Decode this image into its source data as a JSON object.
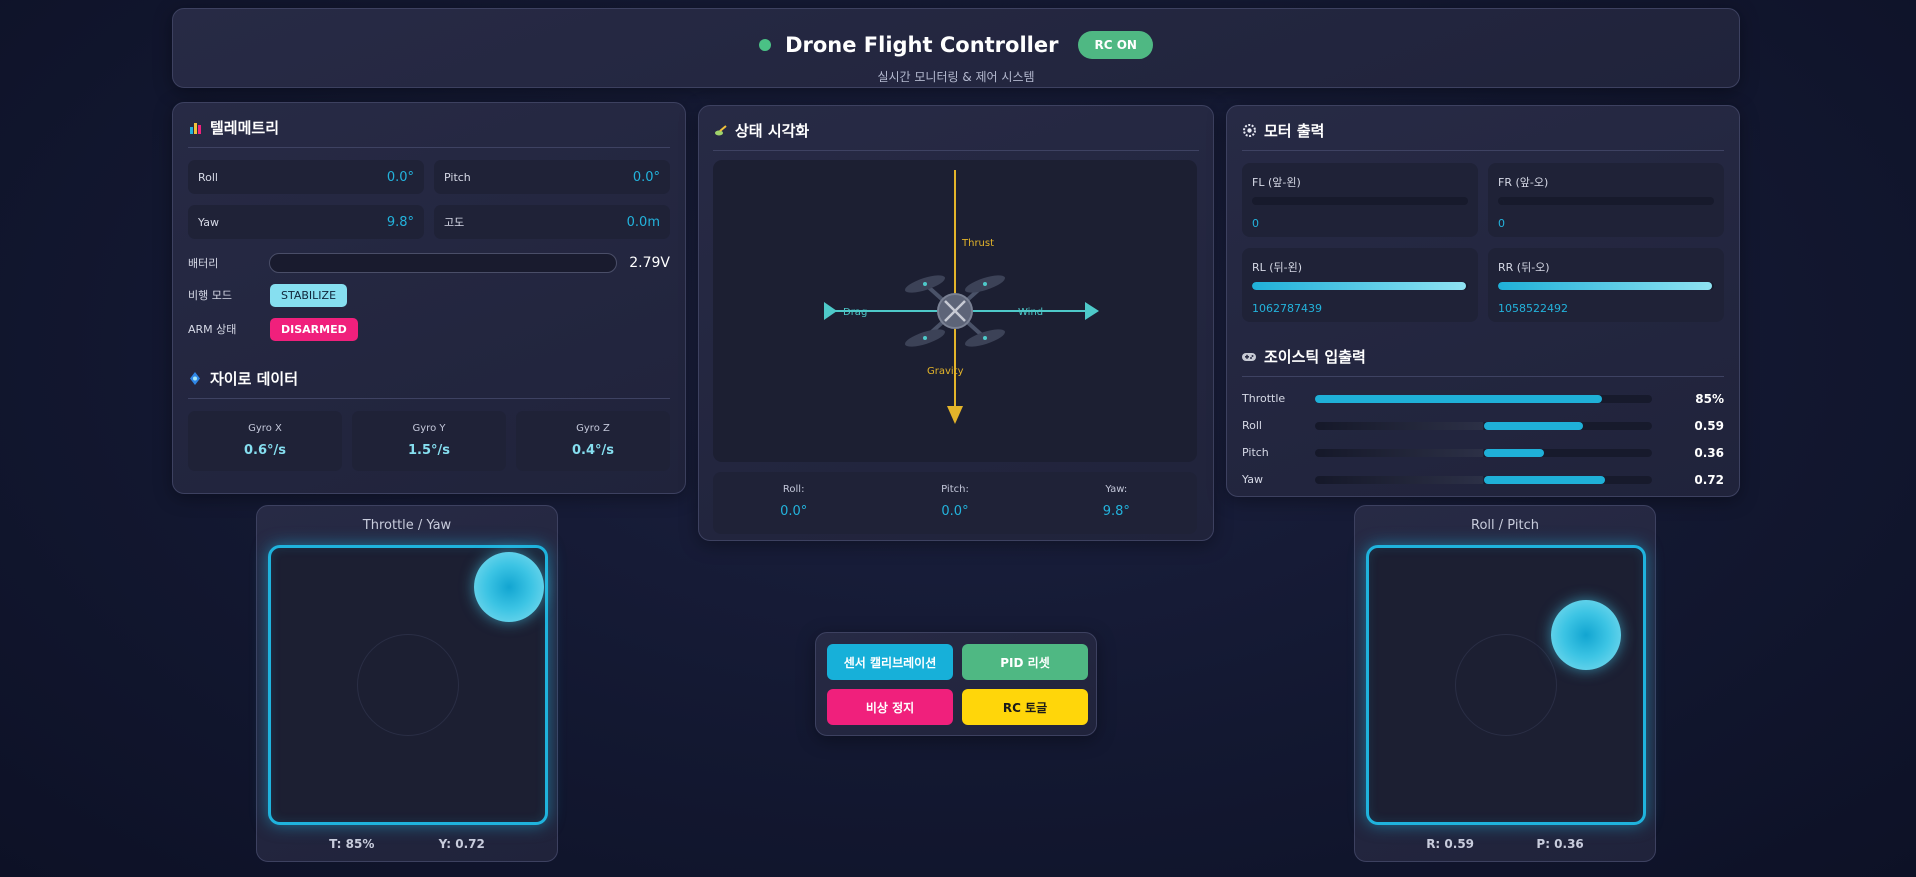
{
  "header": {
    "title": "Drone Flight Controller",
    "rc_badge": "RC ON",
    "subtitle": "실시간 모니터링 & 제어 시스템",
    "status_color": "#4ac185"
  },
  "telemetry": {
    "title": "텔레메트리",
    "icon": "bar-chart-icon",
    "cells": [
      {
        "label": "Roll",
        "value": "0.0°"
      },
      {
        "label": "Pitch",
        "value": "0.0°"
      },
      {
        "label": "Yaw",
        "value": "9.8°"
      },
      {
        "label": "고도",
        "value": "0.0m"
      }
    ],
    "battery_label": "배터리",
    "battery_value": "2.79V",
    "battery_level": 0.0,
    "mode_label": "비행 모드",
    "mode_value": "STABILIZE",
    "arm_label": "ARM 상태",
    "arm_value": "DISARMED"
  },
  "gyro": {
    "title": "자이로 데이터",
    "icon": "gyro-icon",
    "cells": [
      {
        "label": "Gyro X",
        "value": "0.6°/s"
      },
      {
        "label": "Gyro Y",
        "value": "1.5°/s"
      },
      {
        "label": "Gyro Z",
        "value": "0.4°/s"
      }
    ]
  },
  "visual": {
    "title": "상태 시각화",
    "icon": "drone-icon",
    "forces": {
      "thrust": "Thrust",
      "gravity": "Gravity",
      "drag": "Drag",
      "wind": "Wind"
    },
    "readout": [
      {
        "label": "Roll:",
        "value": "0.0°"
      },
      {
        "label": "Pitch:",
        "value": "0.0°"
      },
      {
        "label": "Yaw:",
        "value": "9.8°"
      }
    ]
  },
  "motors": {
    "title": "모터 출력",
    "icon": "gear-icon",
    "items": [
      {
        "label": "FL (앞-왼)",
        "value": "0",
        "level": 0
      },
      {
        "label": "FR (앞-오)",
        "value": "0",
        "level": 0
      },
      {
        "label": "RL (뒤-왼)",
        "value": "1062787439",
        "level": 0.99
      },
      {
        "label": "RR (뒤-오)",
        "value": "1058522492",
        "level": 0.99
      }
    ]
  },
  "joystick_io": {
    "title": "조이스틱 입출력",
    "icon": "gamepad-icon",
    "rows": [
      {
        "label": "Throttle",
        "value": "85%",
        "fraction": 0.85,
        "centered": false
      },
      {
        "label": "Roll",
        "value": "0.59",
        "fraction": 0.59,
        "centered": true
      },
      {
        "label": "Pitch",
        "value": "0.36",
        "fraction": 0.36,
        "centered": true
      },
      {
        "label": "Yaw",
        "value": "0.72",
        "fraction": 0.72,
        "centered": true
      }
    ]
  },
  "sticks": {
    "left": {
      "title": "Throttle / Yaw",
      "readout_a": "T: 85%",
      "readout_b": "Y: 0.72"
    },
    "right": {
      "title": "Roll / Pitch",
      "readout_a": "R: 0.59",
      "readout_b": "P: 0.36"
    }
  },
  "controls": {
    "calibrate": "센서 캘리브레이션",
    "pid_reset": "PID 리셋",
    "emergency_stop": "비상 정지",
    "rc_toggle": "RC 토글"
  },
  "colors": {
    "accent": "#23b3dc",
    "success": "#4fb883",
    "danger": "#f0207c",
    "warning": "#ffd60a",
    "force": "#e3b42a",
    "air": "#4ec9c9"
  }
}
